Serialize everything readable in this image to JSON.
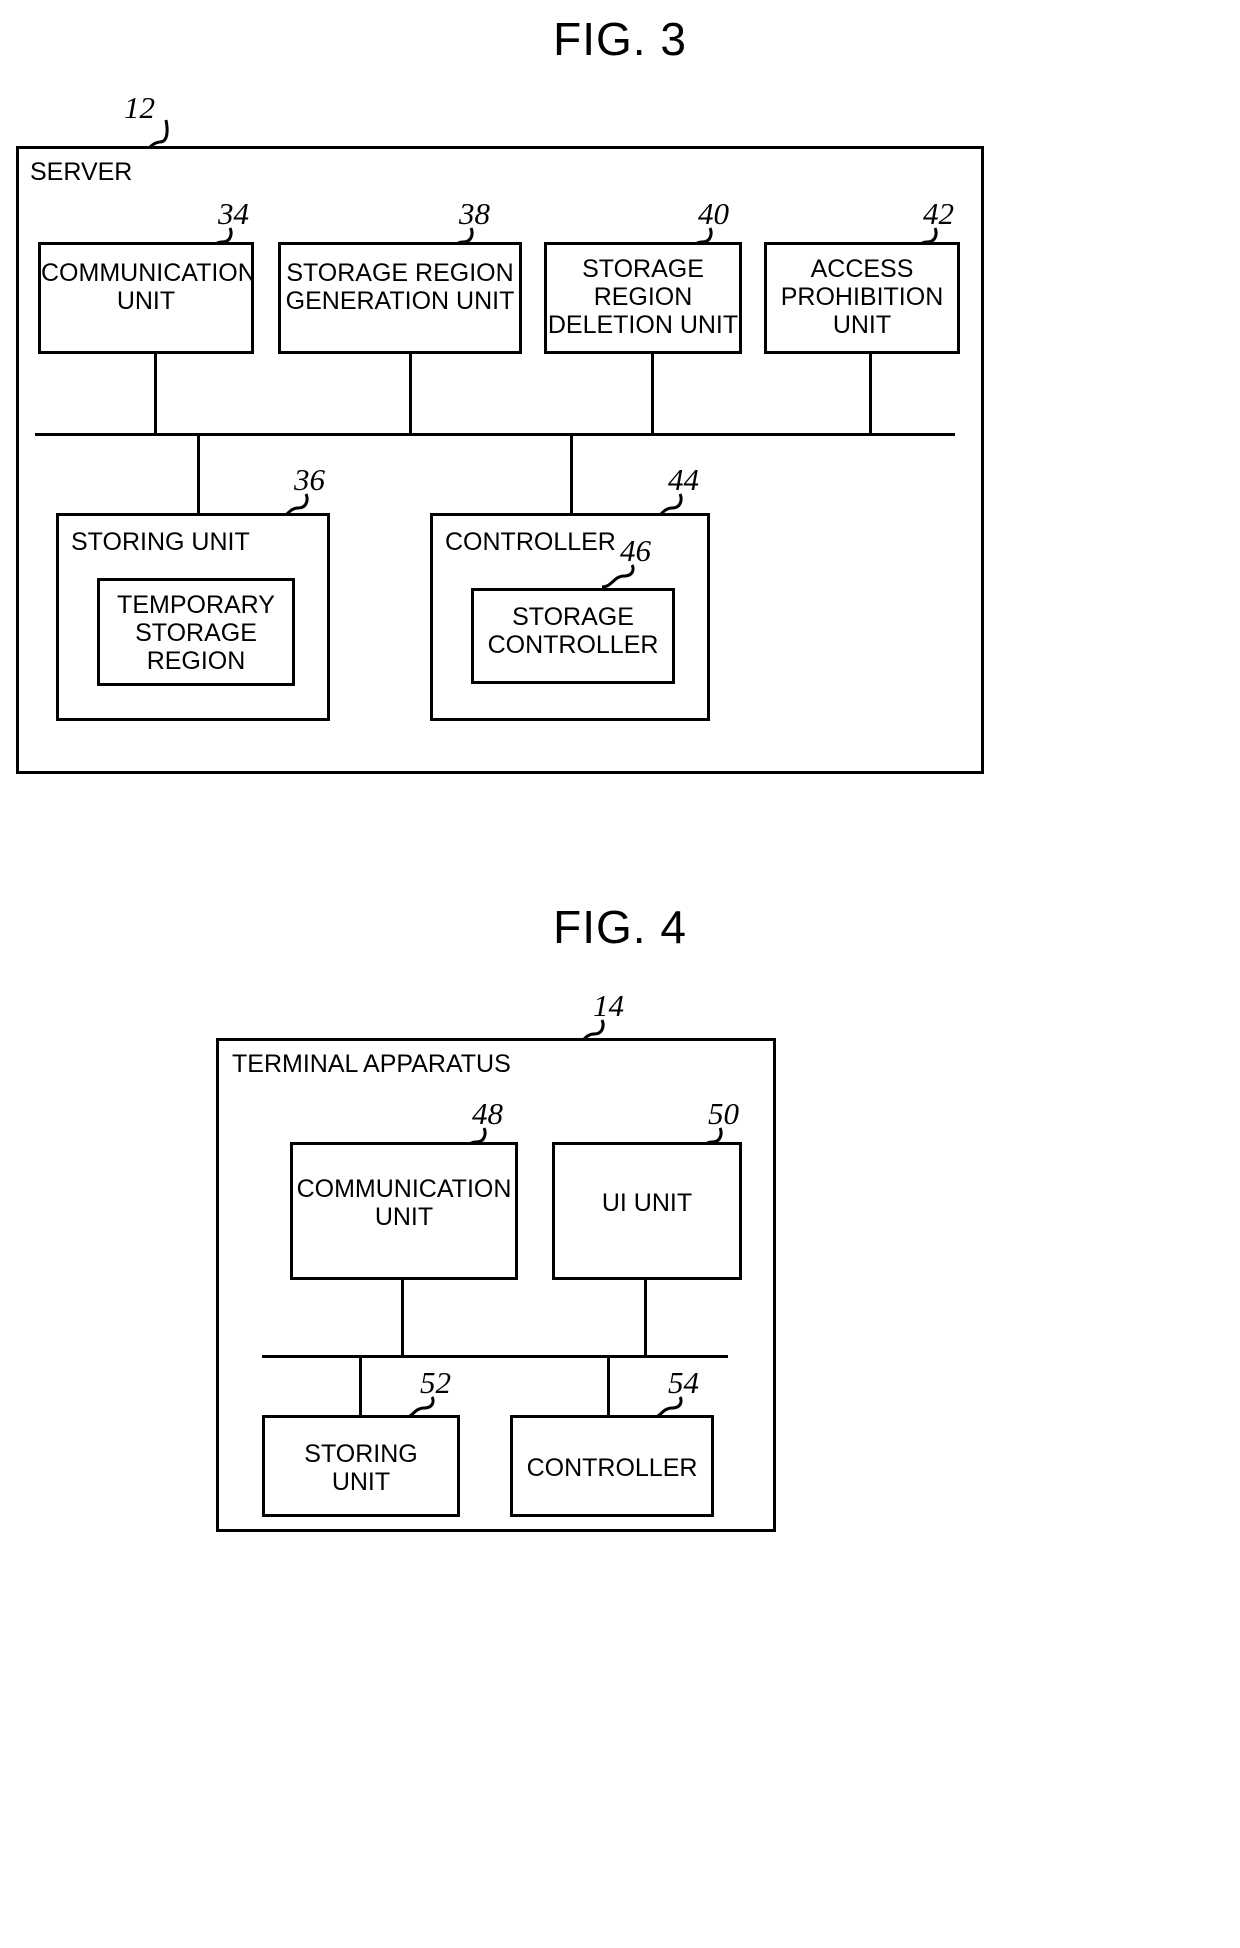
{
  "figures": [
    {
      "title": "FIG. 3",
      "outer": {
        "label": "SERVER",
        "ref": "12"
      },
      "top_row": [
        {
          "label": "COMMUNICATION\nUNIT",
          "ref": "34"
        },
        {
          "label": "STORAGE REGION\nGENERATION UNIT",
          "ref": "38"
        },
        {
          "label": "STORAGE\nREGION\nDELETION UNIT",
          "ref": "40"
        },
        {
          "label": "ACCESS\nPROHIBITION\nUNIT",
          "ref": "42"
        }
      ],
      "bottom_row": [
        {
          "label": "STORING UNIT",
          "ref": "36",
          "inner": {
            "label": "TEMPORARY\nSTORAGE\nREGION",
            "ref": ""
          }
        },
        {
          "label": "CONTROLLER",
          "ref": "44",
          "inner": {
            "label": "STORAGE\nCONTROLLER",
            "ref": "46"
          }
        }
      ]
    },
    {
      "title": "FIG. 4",
      "outer": {
        "label": "TERMINAL APPARATUS",
        "ref": "14"
      },
      "top_row": [
        {
          "label": "COMMUNICATION\nUNIT",
          "ref": "48"
        },
        {
          "label": "UI UNIT",
          "ref": "50"
        }
      ],
      "bottom_row": [
        {
          "label": "STORING\nUNIT",
          "ref": "52"
        },
        {
          "label": "CONTROLLER",
          "ref": "54"
        }
      ]
    }
  ]
}
